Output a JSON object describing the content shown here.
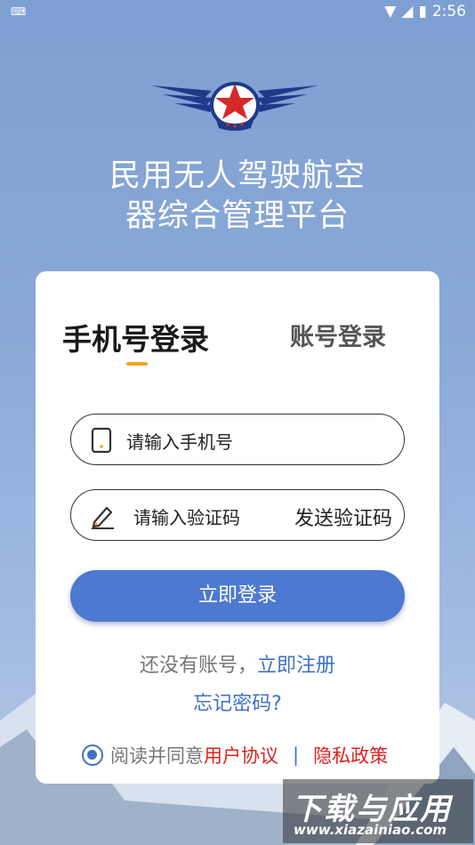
{
  "status_bar": {
    "time": "2:56"
  },
  "app": {
    "title_line1": "民用无人驾驶航空",
    "title_line2": "器综合管理平台"
  },
  "tabs": {
    "phone_login": "手机号登录",
    "account_login": "账号登录"
  },
  "phone_field": {
    "placeholder": "请输入手机号"
  },
  "code_field": {
    "placeholder": "请输入验证码",
    "send_code": "发送验证码"
  },
  "login_button": "立即登录",
  "register": {
    "prompt": "还没有账号，",
    "link": "立即注册"
  },
  "forgot_password": "忘记密码?",
  "agreement": {
    "prefix": "阅读并同意",
    "user_agreement": "用户协议",
    "separator": "|",
    "privacy_policy": "隐私政策",
    "checked": true
  },
  "watermark": {
    "title": "下载与应用",
    "url": "www.xiazainiao.com"
  },
  "colors": {
    "primary": "#4d79d1",
    "link": "#3f71c7",
    "accent": "#f5a623",
    "danger": "#e02020"
  },
  "icons": [
    "keyboard-icon",
    "wifi-icon",
    "signal-icon",
    "battery-icon",
    "emblem-logo",
    "phone-icon",
    "pencil-icon",
    "radio-checked-icon"
  ]
}
